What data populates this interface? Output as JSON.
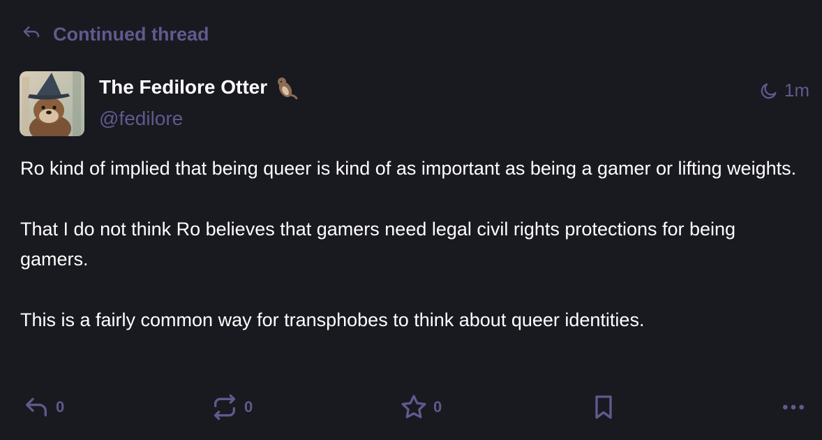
{
  "thread": {
    "label": "Continued thread",
    "icon": "reply-icon"
  },
  "author": {
    "display_name": "The Fedilore Otter",
    "emoji": "otter-emoji",
    "handle": "@fedilore",
    "avatar": "otter-wizard-avatar"
  },
  "timestamp": {
    "icon": "moon-icon",
    "value": "1m"
  },
  "content": {
    "paragraphs": [
      "Ro kind of implied that being queer is kind of as important as being a gamer or lifting weights.",
      "That I do not think Ro believes that gamers need legal civil rights protections for being gamers.",
      "This is a fairly common way for transphobes to think about queer identities."
    ]
  },
  "actions": {
    "reply": {
      "icon": "reply-icon",
      "count": "0"
    },
    "boost": {
      "icon": "boost-icon",
      "count": "0"
    },
    "favourite": {
      "icon": "star-icon",
      "count": "0"
    },
    "bookmark": {
      "icon": "bookmark-icon"
    },
    "more": {
      "icon": "more-icon"
    }
  },
  "colors": {
    "background": "#191920",
    "text": "#ffffff",
    "muted": "#5f5a8e"
  }
}
